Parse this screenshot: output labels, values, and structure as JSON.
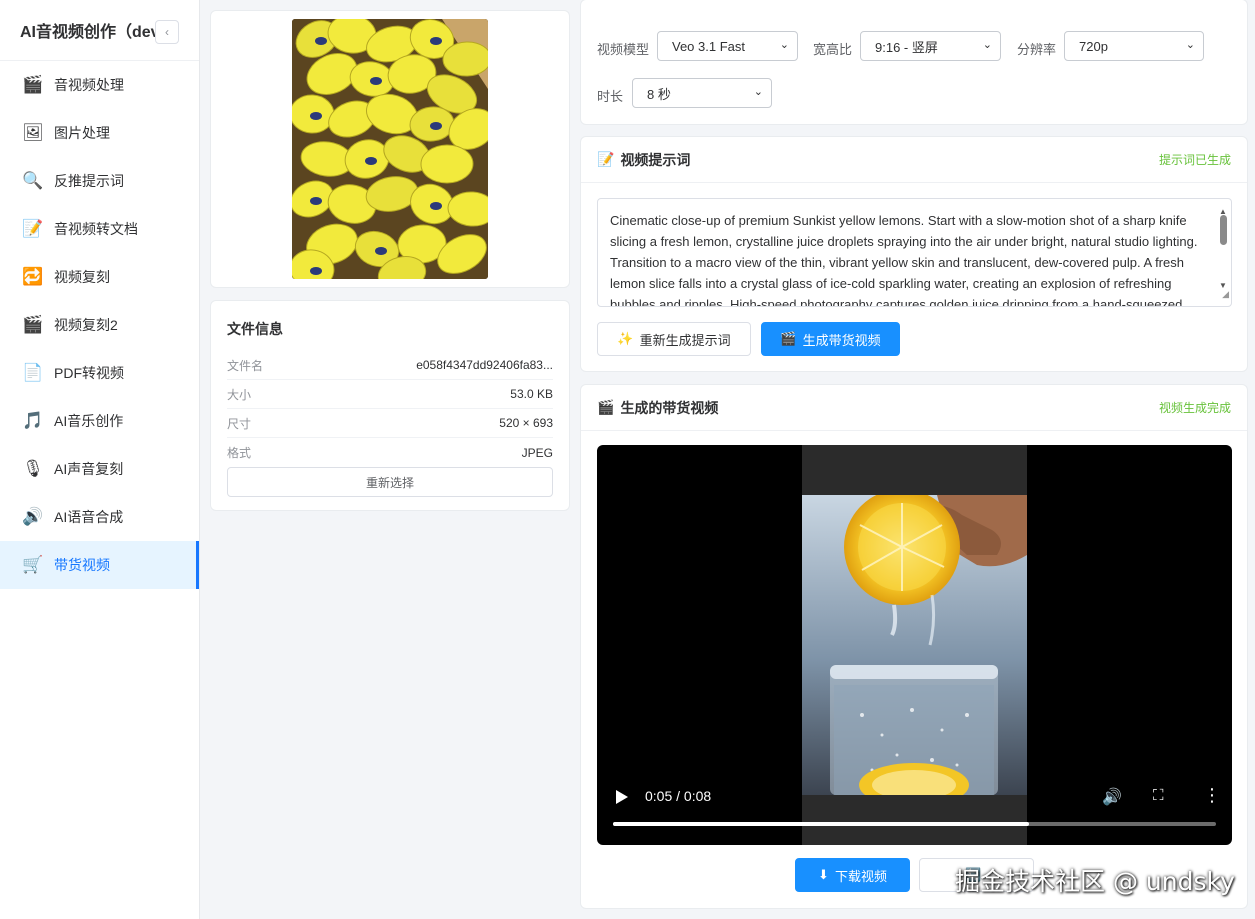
{
  "sidebar": {
    "title": "AI音视频创作（dev",
    "collapse_icon": "‹",
    "items": [
      {
        "label": "音视频处理",
        "icon": "clapperboard"
      },
      {
        "label": "图片处理",
        "icon": "picture"
      },
      {
        "label": "反推提示词",
        "icon": "magnifier"
      },
      {
        "label": "音视频转文档",
        "icon": "memo"
      },
      {
        "label": "视频复刻",
        "icon": "repeat"
      },
      {
        "label": "视频复刻2",
        "icon": "clapperboard"
      },
      {
        "label": "PDF转视频",
        "icon": "page"
      },
      {
        "label": "AI音乐创作",
        "icon": "music-note"
      },
      {
        "label": "AI声音复刻",
        "icon": "microphone"
      },
      {
        "label": "AI语音合成",
        "icon": "speaker"
      },
      {
        "label": "带货视频",
        "icon": "shopping-cart",
        "active": true
      }
    ]
  },
  "file_info": {
    "title": "文件信息",
    "rows": [
      {
        "key": "文件名",
        "value": "e058f4347dd92406fa83..."
      },
      {
        "key": "大小",
        "value": "53.0 KB"
      },
      {
        "key": "尺寸",
        "value": "520 × 693"
      },
      {
        "key": "格式",
        "value": "JPEG"
      }
    ],
    "reselect_label": "重新选择"
  },
  "settings": {
    "model_label": "视频模型",
    "model_value": "Veo 3.1 Fast",
    "ratio_label": "宽高比",
    "ratio_value": "9:16 - 竖屏",
    "resolution_label": "分辨率",
    "resolution_value": "720p",
    "duration_label": "时长",
    "duration_value": "8 秒"
  },
  "prompt": {
    "title": "视频提示词",
    "status": "提示词已生成",
    "text": "Cinematic close-up of premium Sunkist yellow lemons. Start with a slow-motion shot of a sharp knife slicing a fresh lemon, crystalline juice droplets spraying into the air under bright, natural studio lighting. Transition to a macro view of the thin, vibrant yellow skin and translucent, dew-covered pulp. A fresh lemon slice falls into a crystal glass of ice-cold sparkling water, creating an explosion of refreshing bubbles and ripples. High-speed photography captures golden juice dripping from a hand-squeezed",
    "regenerate_label": "重新生成提示词",
    "generate_label": "生成带货视频"
  },
  "video": {
    "title": "生成的带货视频",
    "status": "视频生成完成",
    "time": "0:05 / 0:08",
    "progress": 0.69,
    "download_label": "下载视频"
  },
  "watermark": "掘金技术社区 @ undsky",
  "colors": {
    "primary": "#1890ff",
    "success": "#67c23a",
    "active_bg": "#e6f4ff"
  }
}
